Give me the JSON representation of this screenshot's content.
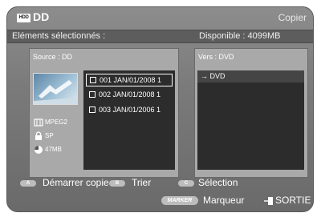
{
  "header": {
    "drive_icon": "HDD",
    "title": "DD",
    "page": "Copier"
  },
  "info": {
    "selected_label": "Eléments sélectionnés :",
    "available": "Disponible : 4099MB"
  },
  "source": {
    "title": "Source : DD",
    "meta": {
      "format": "MPEG2",
      "quality": "SP",
      "size": "47MB"
    },
    "items": [
      {
        "label": "001 JAN/01/2008  1",
        "selected": true
      },
      {
        "label": "002 JAN/01/2008  1",
        "selected": false
      },
      {
        "label": "003 JAN/01/2006  1",
        "selected": false
      }
    ]
  },
  "destination": {
    "title": "Vers : DVD",
    "item": "→ DVD"
  },
  "footer": {
    "key_a": "A",
    "start_copy": "Démarrer copie",
    "key_b": "B",
    "sort": "Trier",
    "key_c": "C",
    "selection": "Sélection",
    "marker_key": "MARKER",
    "marker": "Marqueur",
    "exit": "SORTIE"
  },
  "colors": {
    "panel": "#a9a9a9",
    "list_bg": "#2c2c2c",
    "screen": "#7d7d7d"
  },
  "icons": [
    "hdd-icon",
    "film-icon",
    "lock-icon",
    "disc-icon",
    "exit-icon"
  ]
}
